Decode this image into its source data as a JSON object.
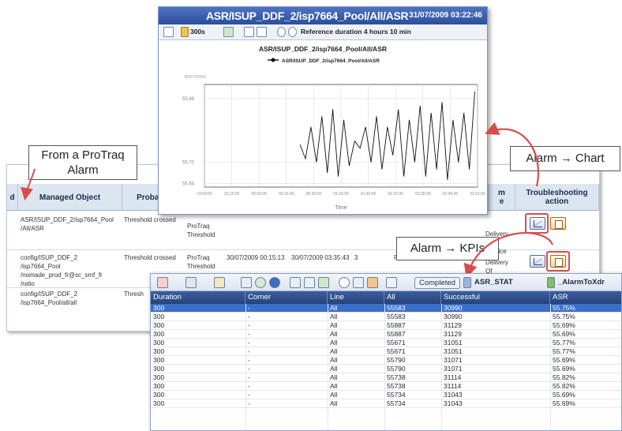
{
  "alarm_table": {
    "columns": [
      {
        "label": "d"
      },
      {
        "label": "Managed Object"
      },
      {
        "label": "Probable"
      },
      {
        "label": "m\ne"
      },
      {
        "label": "Troubleshooting\naction"
      }
    ],
    "rows": [
      {
        "managed_object": "ASR/ISUP_DDF_2/isp7664_Pool\n/All/ASR",
        "probable": "Threshold crossed",
        "type": "ProTraq\nThreshold",
        "state": "Delivery\nOf\nService"
      },
      {
        "managed_object": "config/ISUP_DDF_2\n/isp7664_Pool\n/nomade_prod_fr@sc_smf_fr\n/ratio",
        "probable": "Threshold crossed",
        "type": "ProTraq\nThreshold",
        "raised": "30/07/2009 00:15:13",
        "cleared": "30/07/2009 03:35:43",
        "count": "3",
        "source": "ProT",
        "state": "Delivery\nOf\nService"
      },
      {
        "managed_object": "config/ISUP_DDF_2\n/isp7664_Pool/all/all",
        "probable": "Thresh"
      }
    ]
  },
  "chart_window": {
    "title": "ASR/ISUP_DDF_2/isp7664_Pool/All/ASR",
    "datetime": "31/07/2009 03:22:46",
    "toolbar_interval": "300s",
    "toolbar_reference": "Reference duration 4 hours 10 min"
  },
  "callouts": {
    "protraq": "From a ProTraq\nAlarm",
    "alarm_chart": "Alarm → Chart",
    "alarm_kpis": "Alarm → KPIs"
  },
  "chart_data": {
    "type": "line",
    "title": "ASR/ISUP_DDF_2/isp7664_Pool/All/ASR",
    "xlabel": "Time",
    "ylabel": "",
    "series": [
      {
        "name": "ASR/ISUP_DDF_2/isp7664_Pool/All/ASR",
        "x": [
          0.35,
          0.37,
          0.39,
          0.41,
          0.43,
          0.45,
          0.47,
          0.49,
          0.51,
          0.53,
          0.55,
          0.57,
          0.59,
          0.61,
          0.63,
          0.65,
          0.67,
          0.69,
          0.71,
          0.73,
          0.75,
          0.77,
          0.79,
          0.81,
          0.83,
          0.85,
          0.87,
          0.89,
          0.91,
          0.93,
          0.95,
          0.97,
          0.99
        ],
        "y": [
          55.75,
          55.71,
          55.8,
          55.7,
          55.83,
          55.67,
          55.85,
          55.66,
          55.82,
          55.69,
          55.76,
          55.74,
          55.8,
          55.7,
          55.83,
          55.68,
          55.8,
          55.72,
          55.85,
          55.66,
          55.82,
          55.7,
          55.86,
          55.66,
          55.84,
          55.68,
          55.87,
          55.65,
          55.82,
          55.7,
          55.84,
          55.68,
          55.9
        ]
      }
    ],
    "x_tick_labels": [
      "23:00:00",
      "23:15:00",
      "00:00:00",
      "00:15:00",
      "00:30:00",
      "01:15:00",
      "01:45:00",
      "02:15:00",
      "02:30:00",
      "02:45:00",
      "03:15:00"
    ],
    "y_tick_labels": [
      "55.64",
      "55.70",
      "55.88"
    ],
    "date_label": "30/07/2009",
    "grid": true,
    "legend_position": "top-center"
  },
  "kpi_window": {
    "toolbar": {
      "completed": "Completed",
      "tab1": "ASR_STAT",
      "tab2": "_AlarmToXdr"
    },
    "columns": [
      "Duration",
      "Corner",
      "Line",
      "All",
      "Successful",
      "ASR"
    ],
    "rows": [
      [
        "300",
        "-",
        "All",
        "55583",
        "30990",
        "55.75%"
      ],
      [
        "300",
        "-",
        "All",
        "55583",
        "30990",
        "55.75%"
      ],
      [
        "300",
        "-",
        "All",
        "55887",
        "31129",
        "55.69%"
      ],
      [
        "300",
        "-",
        "All",
        "55887",
        "31129",
        "55.69%"
      ],
      [
        "300",
        "-",
        "All",
        "55671",
        "31051",
        "55.77%"
      ],
      [
        "300",
        "-",
        "All",
        "55671",
        "31051",
        "55.77%"
      ],
      [
        "300",
        "-",
        "All",
        "55790",
        "31071",
        "55.69%"
      ],
      [
        "300",
        "-",
        "All",
        "55790",
        "31071",
        "55.69%"
      ],
      [
        "300",
        "-",
        "All",
        "55738",
        "31114",
        "55.82%"
      ],
      [
        "300",
        "-",
        "All",
        "55738",
        "31114",
        "55.82%"
      ],
      [
        "300",
        "-",
        "All",
        "55734",
        "31043",
        "55.69%"
      ],
      [
        "300",
        "-",
        "All",
        "55734",
        "31043",
        "55.69%"
      ]
    ],
    "selected_row": 0
  },
  "colors": {
    "accent_blue": "#2c4f9c",
    "callout_arrow": "#d94c4c",
    "selection": "#3b6fc8"
  }
}
